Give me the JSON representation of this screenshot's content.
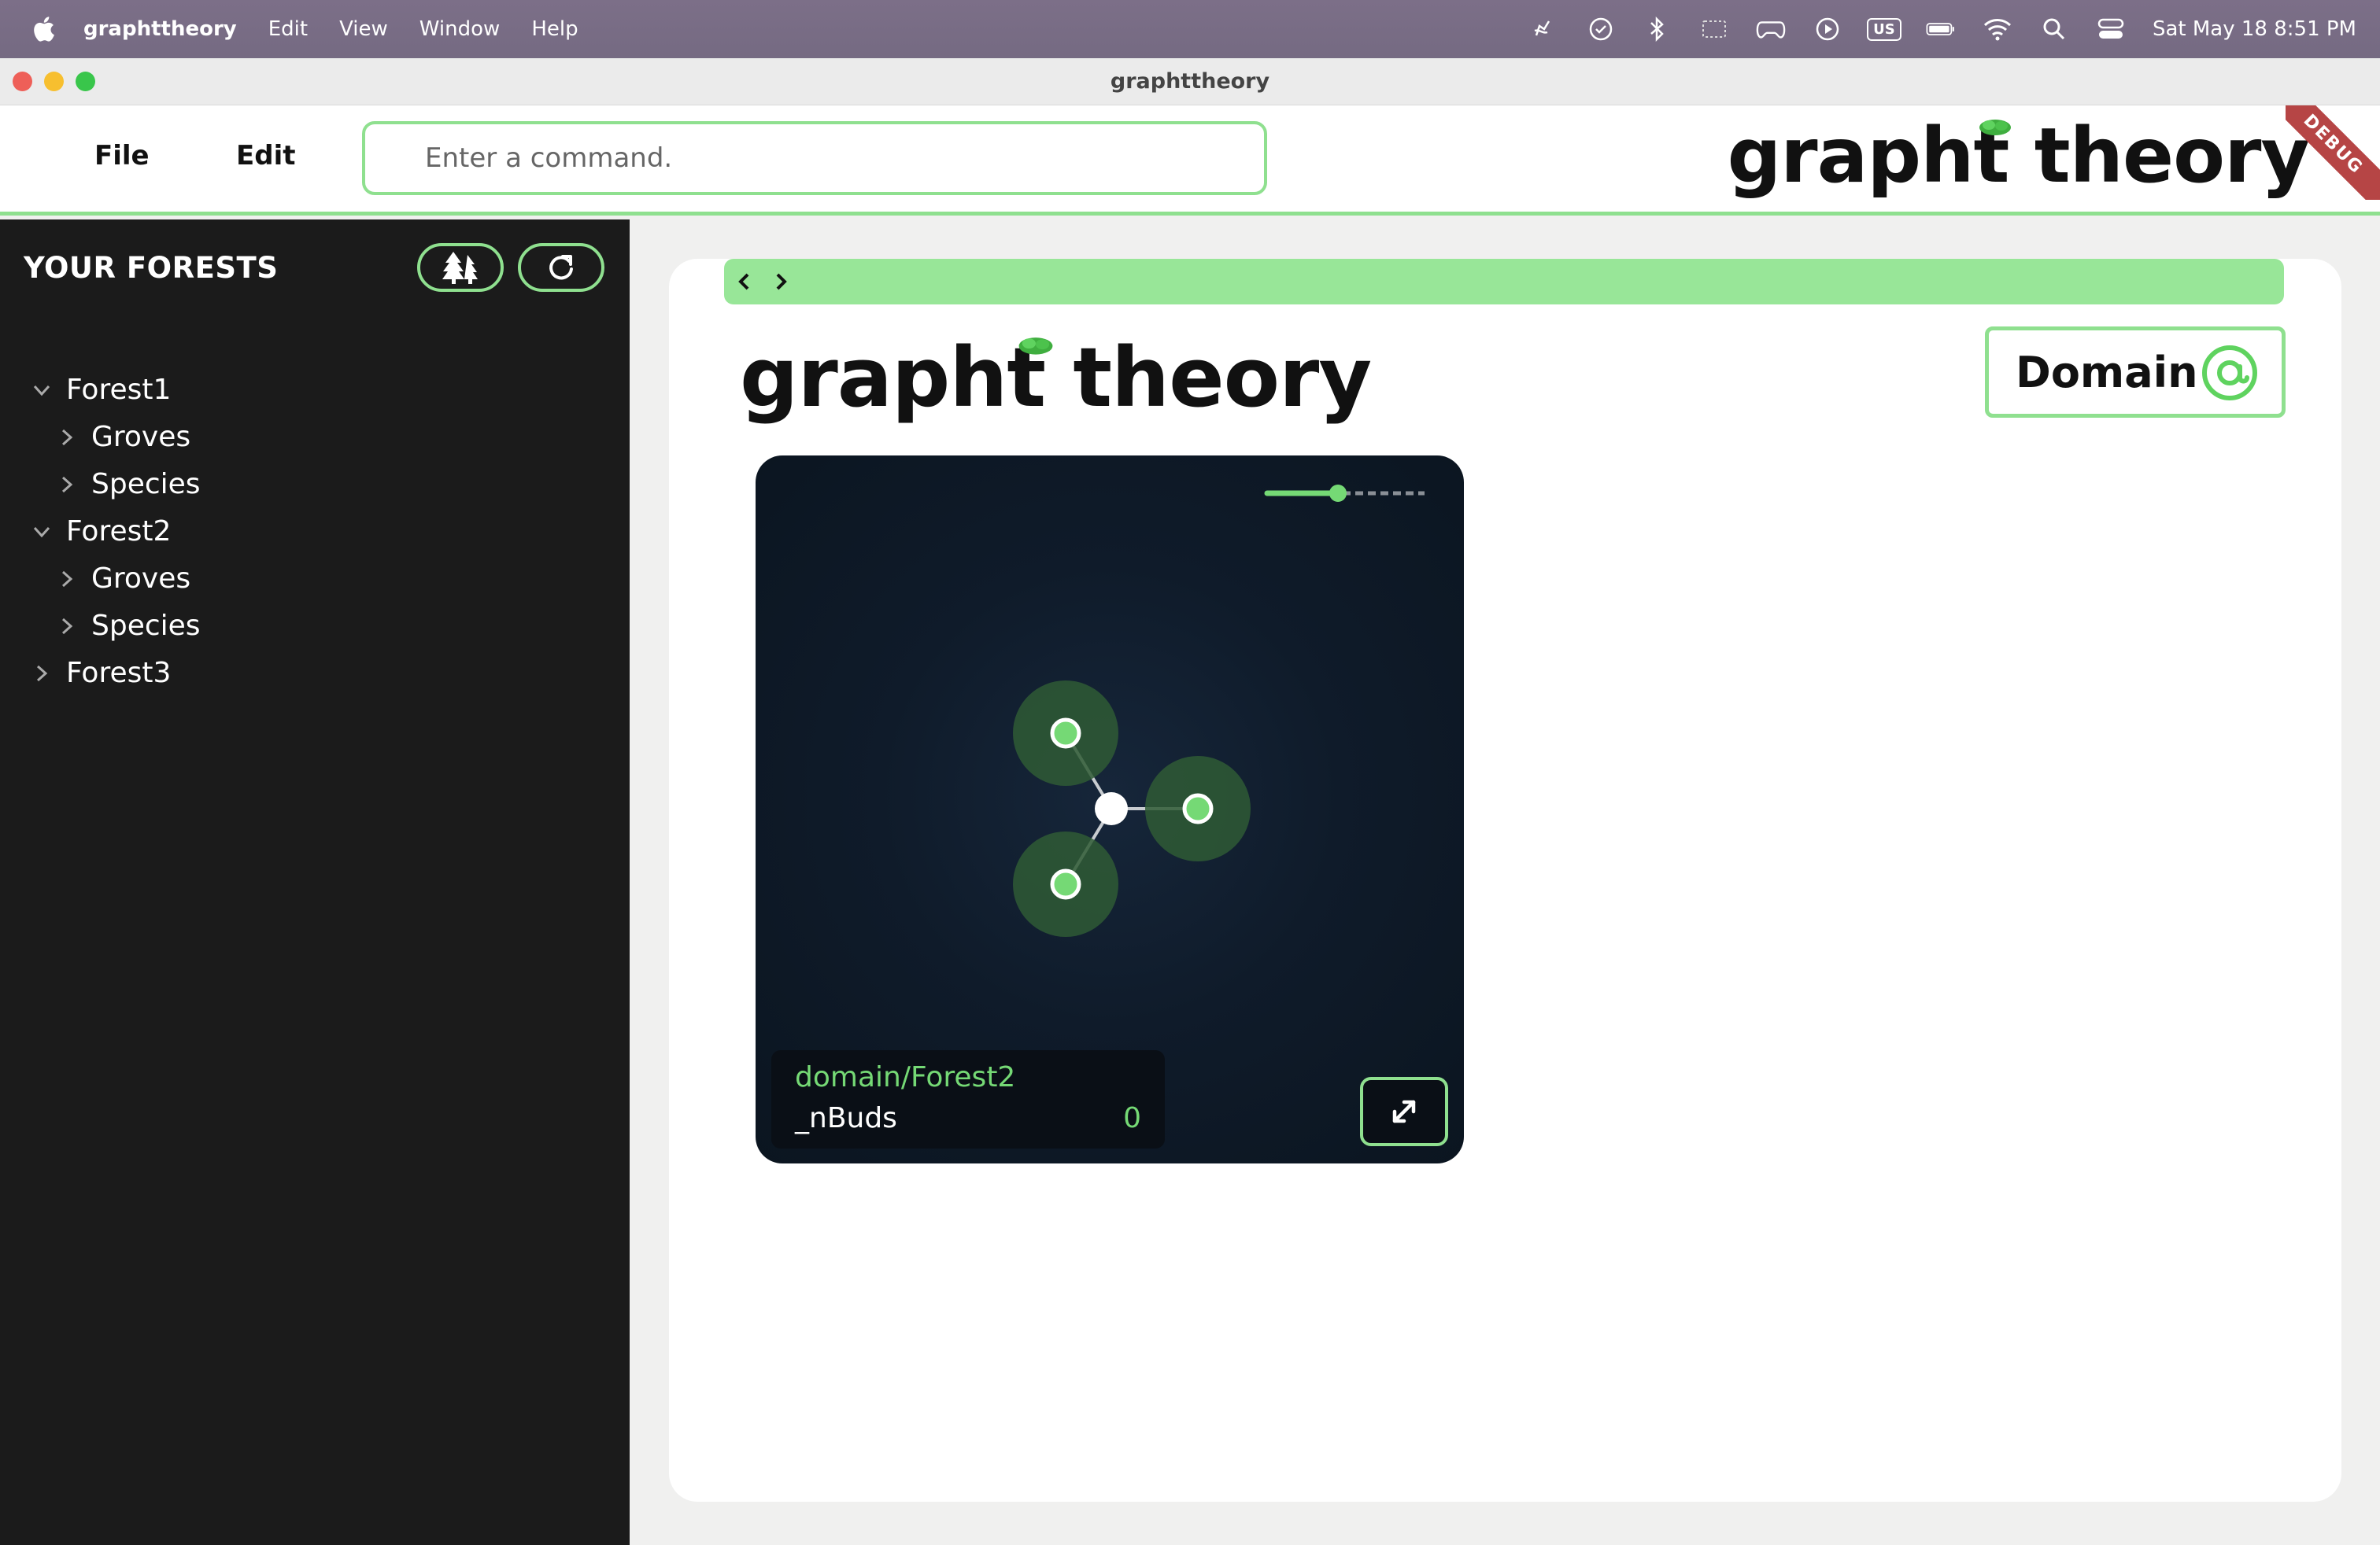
{
  "menubar": {
    "app_name": "graphttheory",
    "items": [
      "Edit",
      "View",
      "Window",
      "Help"
    ],
    "keyboard_layout": "US",
    "clock": "Sat May 18  8:51 PM"
  },
  "window": {
    "title": "graphttheory"
  },
  "header": {
    "file_label": "File",
    "edit_label": "Edit",
    "command_placeholder": "Enter a command.",
    "logo": "grapht theory",
    "debug_ribbon": "DEBUG"
  },
  "sidebar": {
    "title": "YOUR FORESTS",
    "tree": [
      {
        "label": "Forest1",
        "expanded": true,
        "children": [
          "Groves",
          "Species"
        ]
      },
      {
        "label": "Forest2",
        "expanded": true,
        "children": [
          "Groves",
          "Species"
        ]
      },
      {
        "label": "Forest3",
        "expanded": false,
        "children": []
      }
    ]
  },
  "main": {
    "logo": "grapht theory",
    "domain_button": "Domain",
    "graph": {
      "zoom_level": 0.45,
      "nodes": 4,
      "info": {
        "name": "domain/Forest2",
        "key": "_nBuds",
        "value": "0"
      }
    }
  },
  "colors": {
    "accent": "#8fe08f",
    "accent_dark": "#3dbf3d",
    "sidebar_bg": "#1b1b1b",
    "graph_bg": "#0f1b2a",
    "menubar_bg": "#7a6e86"
  }
}
